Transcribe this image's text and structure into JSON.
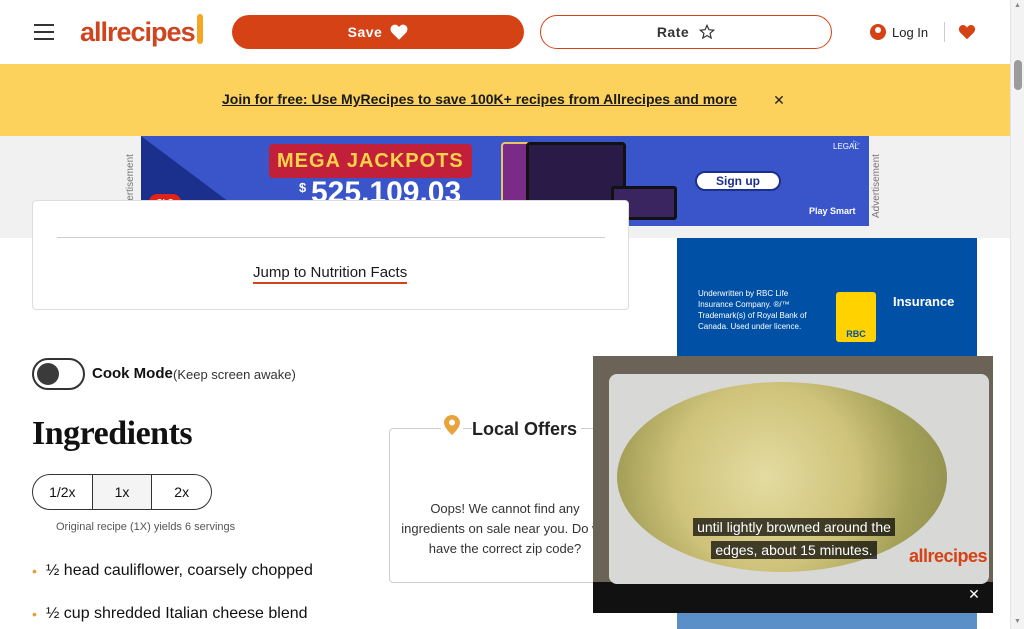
{
  "header": {
    "menu_icon": "hamburger-icon",
    "logo_text": "allrecipes",
    "save_label": "Save",
    "save_icon": "heart-icon",
    "rate_label": "Rate",
    "rate_icon": "star-outline-icon",
    "login_label": "Log In",
    "login_icon": "user-circle-icon",
    "saved_icon": "heart-icon"
  },
  "promo": {
    "link_text": "Join for free: Use MyRecipes to save 100K+ recipes from Allrecipes and more",
    "close_icon": "close-icon",
    "background": "#fcd25c"
  },
  "top_ad": {
    "side_label": "Advertisement",
    "brand": "OLG",
    "headline": "MEGA JACKPOTS",
    "amount_currency": "$",
    "amount": "525,109.03",
    "cta": "Sign up",
    "legal": "LEGAL",
    "footer": "Play Smart"
  },
  "nutrition": {
    "jump_link": "Jump to Nutrition Facts"
  },
  "cook_mode": {
    "label": "Cook Mode",
    "note": "(Keep screen awake)"
  },
  "ingredients": {
    "title": "Ingredients",
    "scale_options": [
      "1/2x",
      "1x",
      "2x"
    ],
    "selected_scale": "1x",
    "yield_note": "Original recipe (1X) yields 6 servings",
    "items": [
      "½ head cauliflower, coarsely chopped",
      "½ cup shredded Italian cheese blend"
    ],
    "bullet_color": "#e2a23a"
  },
  "local_offers": {
    "title": "Local Offers",
    "pin_icon": "location-pin-icon",
    "message": "Oops! We cannot find any ingredients on sale near you. Do we have the correct zip code?"
  },
  "right_ad": {
    "disclaimer": "Underwritten by RBC Life Insurance Company. ®/™ Trademark(s) of Royal Bank of Canada. Used under licence.",
    "logo": "RBC",
    "tagline": "Insurance"
  },
  "video": {
    "caption": "until lightly browned around the edges, about 15 minutes.",
    "watermark": "allrecipes",
    "close_icon": "close-icon"
  },
  "colors": {
    "brand": "#d54215",
    "promo": "#fcd25c",
    "ad_blue": "#0051a5"
  }
}
